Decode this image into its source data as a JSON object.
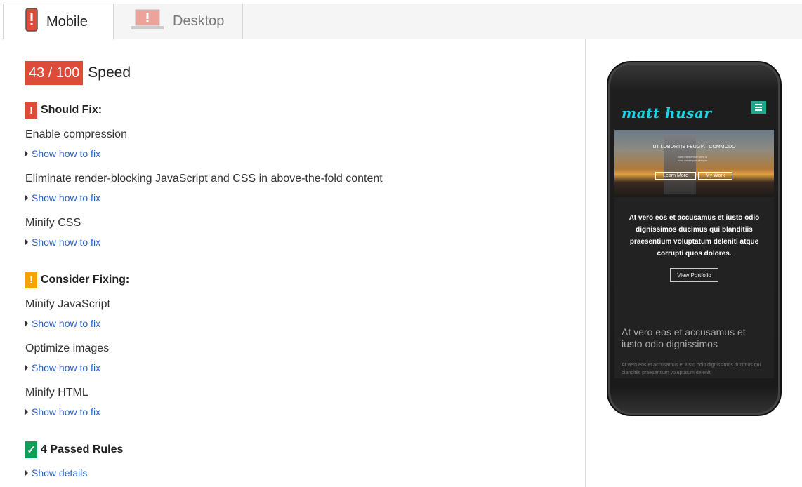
{
  "tabs": [
    {
      "label": "Mobile",
      "icon": "mobile-phone-icon",
      "active": true
    },
    {
      "label": "Desktop",
      "icon": "desktop-monitor-icon",
      "active": false
    }
  ],
  "score": {
    "value": "43 / 100",
    "label": "Speed",
    "color": "#dd4b39"
  },
  "sections": {
    "should_fix": {
      "heading": "Should Fix:",
      "flag": "!",
      "color": "#dd4b39",
      "rules": [
        {
          "title": "Enable compression",
          "link": "Show how to fix"
        },
        {
          "title": "Eliminate render-blocking JavaScript and CSS in above-the-fold content",
          "link": "Show how to fix"
        },
        {
          "title": "Minify CSS",
          "link": "Show how to fix"
        }
      ]
    },
    "consider_fixing": {
      "heading": "Consider Fixing:",
      "flag": "!",
      "color": "#f5a300",
      "rules": [
        {
          "title": "Minify JavaScript",
          "link": "Show how to fix"
        },
        {
          "title": "Optimize images",
          "link": "Show how to fix"
        },
        {
          "title": "Minify HTML",
          "link": "Show how to fix"
        }
      ]
    },
    "passed": {
      "heading": "4 Passed Rules",
      "flag": "✓",
      "color": "#0f9d58",
      "link": "Show details"
    }
  },
  "preview": {
    "logo": "matt husar",
    "hero_title": "UT LOBORTIS FEUGIAT COMMODO",
    "hero_sub": "Nam elementum sem id urna consequat semper",
    "hero_buttons": [
      "Learn More",
      "My Work"
    ],
    "body_text": "At vero eos et accusamus et iusto odio dignissimos ducimus qui blanditiis praesentium voluptatum deleniti atque corrupti quos dolores.",
    "portfolio_button": "View Portfolio",
    "section2_title": "At vero eos et accusamus et iusto odio dignissimos",
    "section2_text": "At vero eos et accusamus et iusto odio dignissimos ducimus qui blanditiis praesentium voluptatum deleniti"
  }
}
